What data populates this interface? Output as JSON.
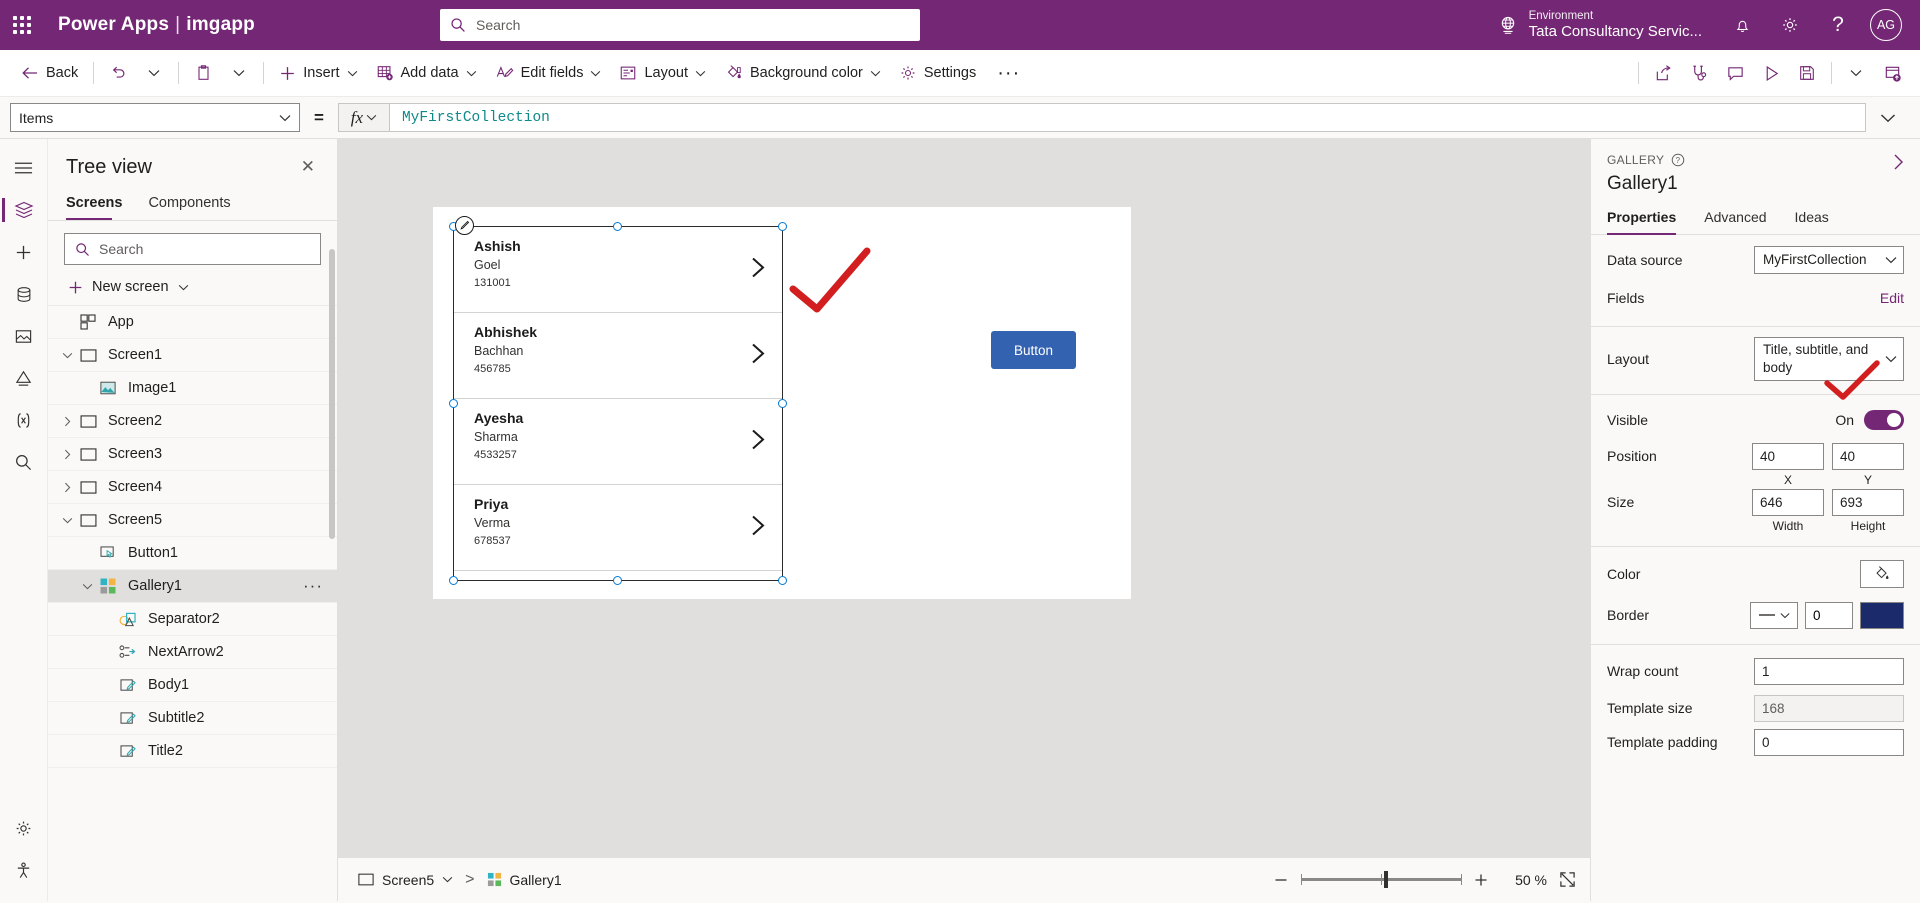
{
  "header": {
    "brand": "Power Apps",
    "separator": "|",
    "app_name": "imgapp",
    "search_placeholder": "Search",
    "environment_label": "Environment",
    "environment_value": "Tata Consultancy Servic...",
    "avatar_initials": "AG",
    "brand_color": "#742774"
  },
  "commandbar": {
    "back": "Back",
    "insert": "Insert",
    "add_data": "Add data",
    "edit_fields": "Edit fields",
    "layout": "Layout",
    "background_color": "Background color",
    "settings": "Settings",
    "overflow": "···"
  },
  "formulabar": {
    "property": "Items",
    "equals": "=",
    "fx": "fx",
    "expression": "MyFirstCollection"
  },
  "treeview": {
    "title": "Tree view",
    "tabs": [
      {
        "label": "Screens",
        "active": true
      },
      {
        "label": "Components",
        "active": false
      }
    ],
    "search_placeholder": "Search",
    "new_screen": "New screen",
    "items": [
      {
        "label": "App",
        "icon": "app-icon",
        "indent": 0,
        "chevron": "",
        "selected": false
      },
      {
        "label": "Screen1",
        "icon": "screen-icon",
        "indent": 0,
        "chevron": "down",
        "selected": false
      },
      {
        "label": "Image1",
        "icon": "image-icon",
        "indent": 1,
        "chevron": "",
        "selected": false
      },
      {
        "label": "Screen2",
        "icon": "screen-icon",
        "indent": 0,
        "chevron": "right",
        "selected": false
      },
      {
        "label": "Screen3",
        "icon": "screen-icon",
        "indent": 0,
        "chevron": "right",
        "selected": false
      },
      {
        "label": "Screen4",
        "icon": "screen-icon",
        "indent": 0,
        "chevron": "right",
        "selected": false
      },
      {
        "label": "Screen5",
        "icon": "screen-icon",
        "indent": 0,
        "chevron": "down",
        "selected": false
      },
      {
        "label": "Button1",
        "icon": "button-icon",
        "indent": 1,
        "chevron": "",
        "selected": false
      },
      {
        "label": "Gallery1",
        "icon": "gallery-icon",
        "indent": 1,
        "chevron": "down",
        "selected": true,
        "ellipsis": "···"
      },
      {
        "label": "Separator2",
        "icon": "separator-icon",
        "indent": 2,
        "chevron": "",
        "selected": false
      },
      {
        "label": "NextArrow2",
        "icon": "nextarrow-icon",
        "indent": 2,
        "chevron": "",
        "selected": false
      },
      {
        "label": "Body1",
        "icon": "label-icon",
        "indent": 2,
        "chevron": "",
        "selected": false
      },
      {
        "label": "Subtitle2",
        "icon": "label-icon",
        "indent": 2,
        "chevron": "",
        "selected": false
      },
      {
        "label": "Title2",
        "icon": "label-icon",
        "indent": 2,
        "chevron": "",
        "selected": false
      }
    ]
  },
  "canvas": {
    "gallery_items": [
      {
        "title": "Ashish",
        "subtitle": "Goel",
        "body": "131001"
      },
      {
        "title": "Abhishek",
        "subtitle": "Bachhan",
        "body": "456785"
      },
      {
        "title": "Ayesha",
        "subtitle": "Sharma",
        "body": "4533257"
      },
      {
        "title": "Priya",
        "subtitle": "Verma",
        "body": "678537"
      }
    ],
    "button_label": "Button",
    "annotation_color": "#d21e1e"
  },
  "statusbar": {
    "screen_name": "Screen5",
    "control_name": "Gallery1",
    "zoom_value": "50",
    "zoom_unit": "%"
  },
  "properties": {
    "kind": "GALLERY",
    "name": "Gallery1",
    "tabs": [
      {
        "label": "Properties",
        "active": true
      },
      {
        "label": "Advanced",
        "active": false
      },
      {
        "label": "Ideas",
        "active": false
      }
    ],
    "rows": {
      "data_source_label": "Data source",
      "data_source_value": "MyFirstCollection",
      "fields_label": "Fields",
      "fields_action": "Edit",
      "layout_label": "Layout",
      "layout_value": "Title, subtitle, and body",
      "visible_label": "Visible",
      "visible_state": "On",
      "position_label": "Position",
      "position_x": "40",
      "position_y": "40",
      "position_x_caption": "X",
      "position_y_caption": "Y",
      "size_label": "Size",
      "size_width": "646",
      "size_height": "693",
      "size_width_caption": "Width",
      "size_height_caption": "Height",
      "color_label": "Color",
      "border_label": "Border",
      "border_width": "0",
      "border_color": "#1b2a6b",
      "wrap_count_label": "Wrap count",
      "wrap_count_value": "1",
      "template_size_label": "Template size",
      "template_size_value": "168",
      "template_padding_label": "Template padding",
      "template_padding_value": "0"
    }
  }
}
